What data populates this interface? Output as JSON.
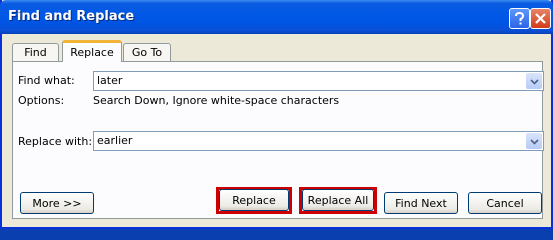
{
  "window": {
    "title": "Find and Replace"
  },
  "titlebar": {
    "buttons": [
      "help-icon",
      "close-icon"
    ]
  },
  "tabs": [
    {
      "label": "Find",
      "active": false
    },
    {
      "label": "Replace",
      "active": true
    },
    {
      "label": "Go To",
      "active": false
    }
  ],
  "find": {
    "label": "Find what:",
    "value": "later"
  },
  "options": {
    "label": "Options:",
    "value": "Search Down, Ignore white-space characters"
  },
  "replace_with": {
    "label": "Replace with:",
    "value": "earlier"
  },
  "buttons": {
    "more": "More >>",
    "replace": "Replace",
    "replace_all": "Replace All",
    "find_next": "Find Next",
    "cancel": "Cancel"
  },
  "colors": {
    "titlebar": "#0054e3",
    "highlight": "#cc0000",
    "face": "#ece9d8"
  }
}
